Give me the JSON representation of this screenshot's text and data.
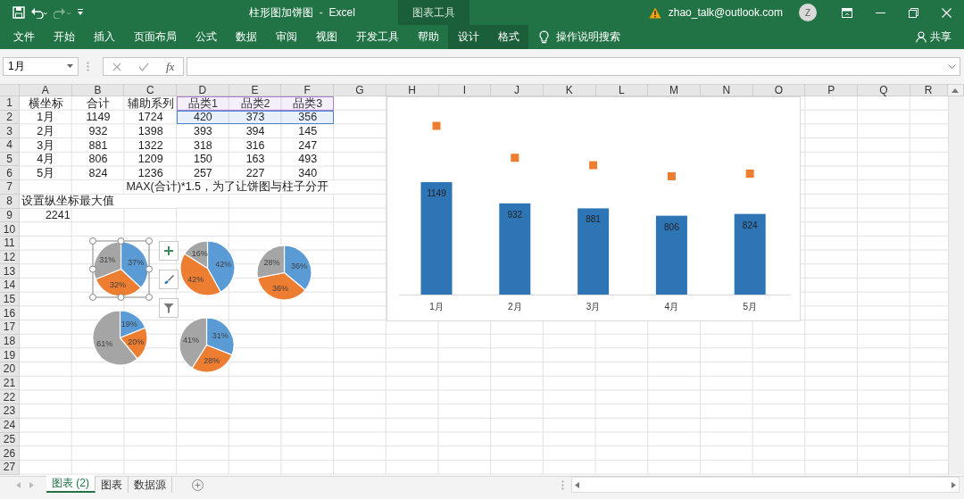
{
  "window": {
    "title": "柱形图加饼图  -  Excel",
    "context_group": "图表工具",
    "account": "zhao_talk@outlook.com",
    "avatar": "Z"
  },
  "quick_access": [
    {
      "kind": "save",
      "disabled": false
    },
    {
      "kind": "undo",
      "disabled": false
    },
    {
      "kind": "redo",
      "disabled": true
    },
    {
      "kind": "customize",
      "disabled": false
    }
  ],
  "ribbon_tabs": [
    {
      "label": "文件",
      "contextual": false
    },
    {
      "label": "开始",
      "contextual": false
    },
    {
      "label": "插入",
      "contextual": false
    },
    {
      "label": "页面布局",
      "contextual": false
    },
    {
      "label": "公式",
      "contextual": false
    },
    {
      "label": "数据",
      "contextual": false
    },
    {
      "label": "审阅",
      "contextual": false
    },
    {
      "label": "视图",
      "contextual": false
    },
    {
      "label": "开发工具",
      "contextual": false
    },
    {
      "label": "帮助",
      "contextual": false
    },
    {
      "label": "设计",
      "contextual": true
    },
    {
      "label": "格式",
      "contextual": true
    }
  ],
  "tell_me": "操作说明搜索",
  "share": "共享",
  "formula_bar": {
    "name_box": "1月",
    "fx": "fx"
  },
  "sheet": {
    "columns": [
      "A",
      "B",
      "C",
      "D",
      "E",
      "F",
      "G",
      "H",
      "I",
      "J",
      "K",
      "L",
      "M",
      "N",
      "O",
      "P",
      "Q",
      "R"
    ],
    "rows": [
      {
        "header": "1",
        "kind": "center",
        "name_range": true,
        "cells": {
          "A": "横坐标",
          "B": "合计",
          "C": "辅助系列",
          "D": "品类1",
          "E": "品类2",
          "F": "品类3"
        }
      },
      {
        "header": "2",
        "kind": "center",
        "value_range": true,
        "cells": {
          "A": "1月",
          "B": "1149",
          "C": "1724",
          "D": "420",
          "E": "373",
          "F": "356"
        }
      },
      {
        "header": "3",
        "kind": "center",
        "cells": {
          "A": "2月",
          "B": "932",
          "C": "1398",
          "D": "393",
          "E": "394",
          "F": "145"
        }
      },
      {
        "header": "4",
        "kind": "center",
        "cells": {
          "A": "3月",
          "B": "881",
          "C": "1322",
          "D": "318",
          "E": "316",
          "F": "247"
        }
      },
      {
        "header": "5",
        "kind": "center",
        "cells": {
          "A": "4月",
          "B": "806",
          "C": "1209",
          "D": "150",
          "E": "163",
          "F": "493"
        }
      },
      {
        "header": "6",
        "kind": "center",
        "cells": {
          "A": "5月",
          "B": "824",
          "C": "1236",
          "D": "257",
          "E": "227",
          "F": "340"
        }
      },
      {
        "header": "7",
        "kind": "spill",
        "cells": {
          "C": "MAX(合计)*1.5，为了让饼图与柱子分开"
        }
      },
      {
        "header": "8",
        "kind": "spill",
        "cells": {
          "A": "设置纵坐标最大值"
        }
      },
      {
        "header": "9",
        "kind": "number",
        "cells": {
          "A": "2241"
        }
      },
      {
        "header": "10"
      },
      {
        "header": "11"
      },
      {
        "header": "12"
      },
      {
        "header": "13"
      },
      {
        "header": "14"
      },
      {
        "header": "15"
      },
      {
        "header": "16"
      },
      {
        "header": "17"
      },
      {
        "header": "18"
      },
      {
        "header": "19"
      },
      {
        "header": "20"
      },
      {
        "header": "21"
      },
      {
        "header": "22"
      },
      {
        "header": "23"
      },
      {
        "header": "24"
      },
      {
        "header": "25"
      },
      {
        "header": "26"
      },
      {
        "header": "27"
      }
    ]
  },
  "pies": [
    {
      "selected": true,
      "chart_data": {
        "type": "pie",
        "values": [
          37,
          32,
          31
        ],
        "value_labels": [
          "37%",
          "32%",
          "31%"
        ]
      }
    },
    {
      "selected": false,
      "chart_data": {
        "type": "pie",
        "values": [
          42,
          42,
          16
        ],
        "value_labels": [
          "42%",
          "42%",
          "16%"
        ]
      }
    },
    {
      "selected": false,
      "chart_data": {
        "type": "pie",
        "values": [
          36,
          36,
          28
        ],
        "value_labels": [
          "36%",
          "36%",
          "28%"
        ]
      }
    },
    {
      "selected": false,
      "chart_data": {
        "type": "pie",
        "values": [
          19,
          20,
          61
        ],
        "value_labels": [
          "19%",
          "20%",
          "61%"
        ]
      }
    },
    {
      "selected": false,
      "chart_data": {
        "type": "pie",
        "values": [
          31,
          28,
          41
        ],
        "value_labels": [
          "31%",
          "28%",
          "41%"
        ]
      }
    }
  ],
  "column_chart": {
    "chart_data": {
      "type": "bar",
      "categories": [
        "1月",
        "2月",
        "3月",
        "4月",
        "5月"
      ],
      "series": [
        {
          "type": "bar",
          "color": "#2e75b6",
          "values": [
            1149,
            932,
            881,
            806,
            824
          ],
          "value_labels": [
            "1149",
            "932",
            "881",
            "806",
            "824"
          ]
        },
        {
          "type": "scatter",
          "color": "#ed7d31",
          "values": [
            1724,
            1398,
            1322,
            1209,
            1236
          ],
          "value_labels": [
            null,
            null,
            null,
            null,
            null
          ]
        }
      ]
    }
  },
  "sheet_tabs": [
    {
      "label": "图表 (2)",
      "selected": true
    },
    {
      "label": "图表",
      "selected": false
    },
    {
      "label": "数据源",
      "selected": false
    }
  ]
}
